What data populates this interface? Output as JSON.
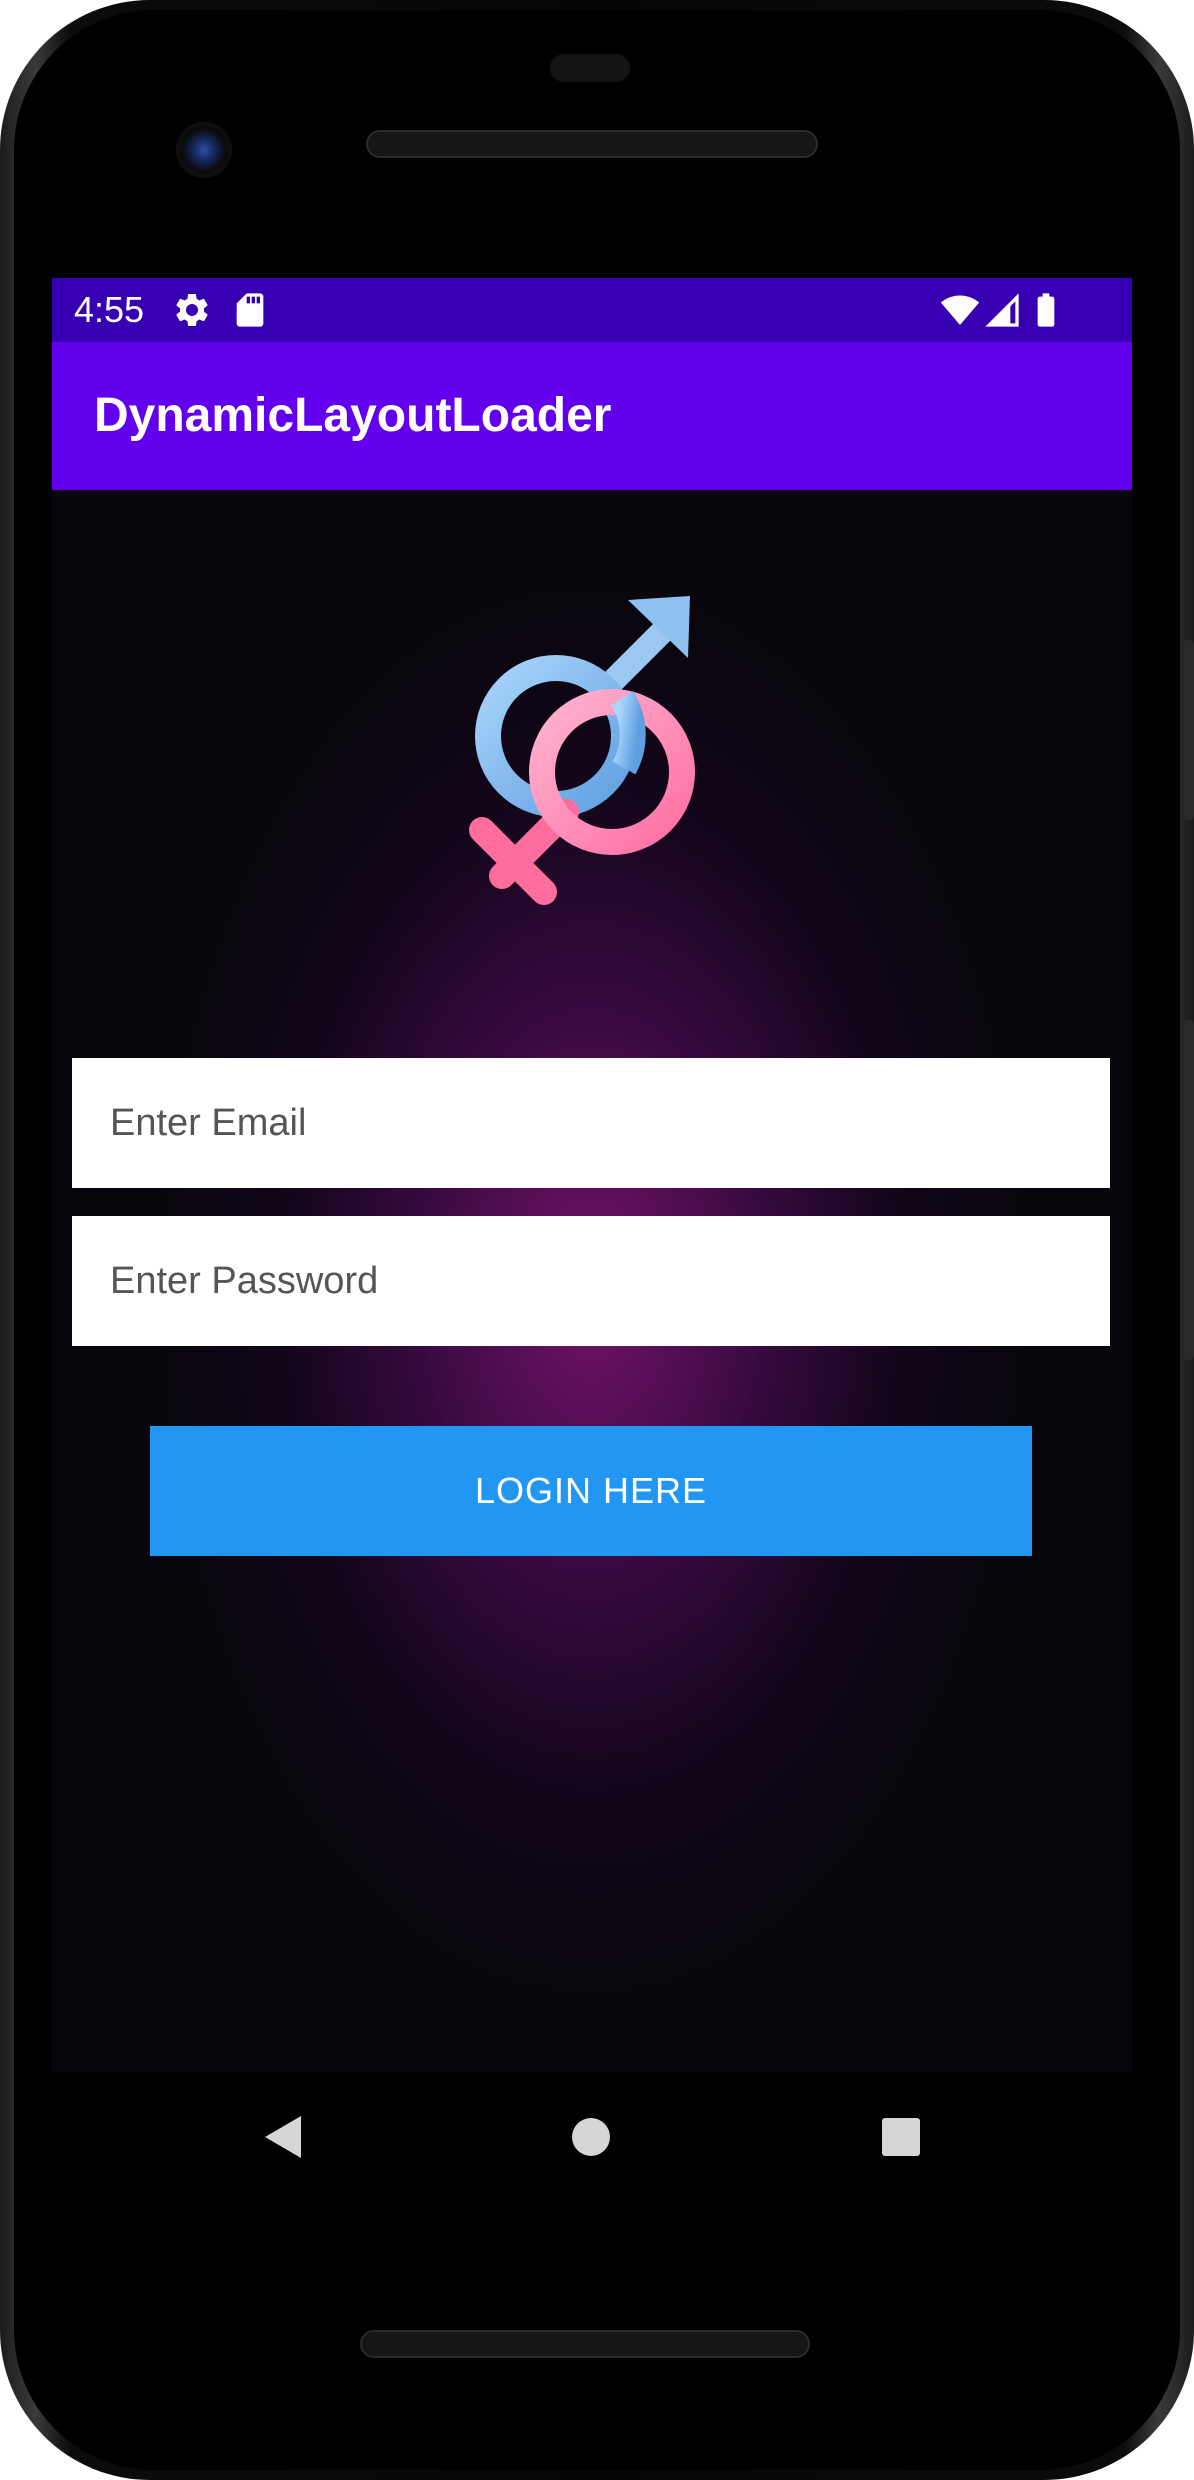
{
  "status_bar": {
    "time": "4:55",
    "left_icons": [
      "gear-icon",
      "sd-card-icon"
    ],
    "right_icons": [
      "wifi-icon",
      "signal-icon",
      "battery-icon"
    ],
    "color": "#3700b3"
  },
  "app_bar": {
    "title": "DynamicLayoutLoader",
    "color": "#6200ee"
  },
  "logo": {
    "icon": "gender-symbols-icon",
    "male_color": "#7fb6ec",
    "female_color": "#ff7fb0"
  },
  "form": {
    "email_placeholder": "Enter Email",
    "email_value": "",
    "password_placeholder": "Enter Password",
    "password_value": "",
    "login_label": "LOGIN HERE",
    "button_color": "#2196f3"
  },
  "nav_bar": {
    "icons": [
      "back-icon",
      "home-icon",
      "recents-icon"
    ]
  }
}
